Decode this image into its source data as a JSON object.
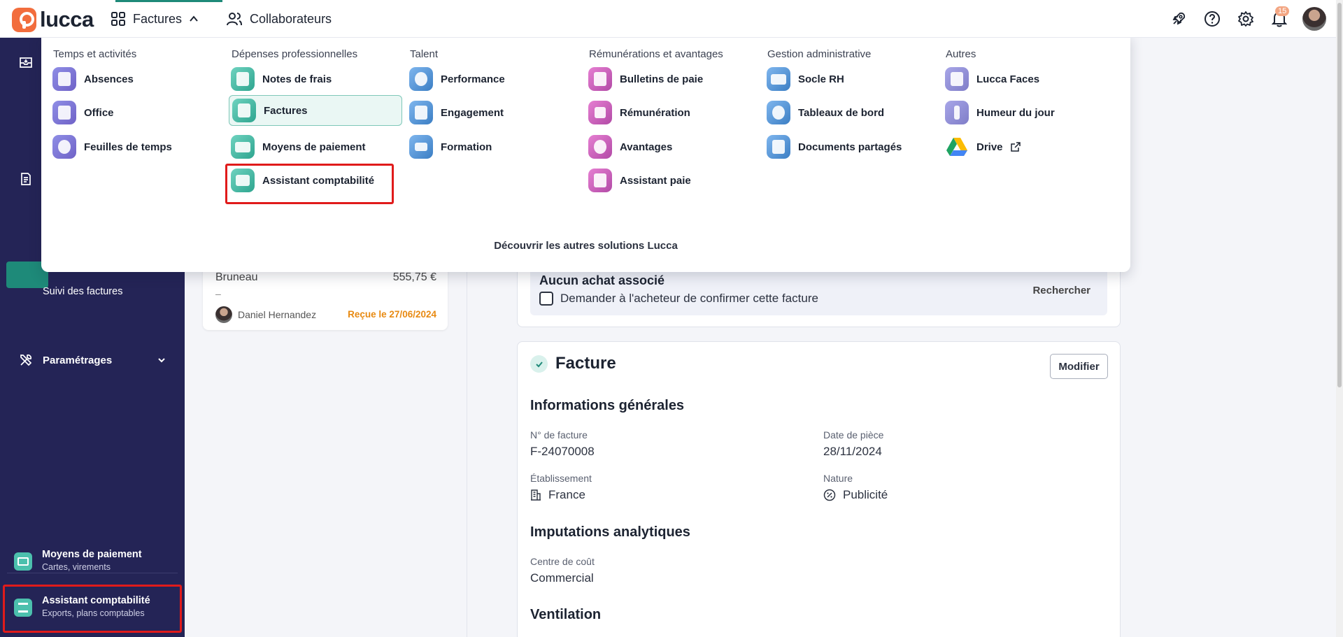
{
  "topbar": {
    "logo_text": "lucca",
    "nav": [
      {
        "label": "Factures",
        "icon": "grid-icon",
        "expanded": true
      },
      {
        "label": "Collaborateurs",
        "icon": "people-icon"
      }
    ],
    "notification_count": "15",
    "icons": [
      "rocket-icon",
      "help-icon",
      "settings-icon",
      "bell-icon"
    ]
  },
  "menu": {
    "columns": [
      {
        "title": "Temps et activités",
        "items": [
          "Absences",
          "Office",
          "Feuilles de temps"
        ]
      },
      {
        "title": "Dépenses professionnelles",
        "items": [
          "Notes de frais",
          "Factures",
          "Moyens de paiement",
          "Assistant comptabilité"
        ]
      },
      {
        "title": "Talent",
        "items": [
          "Performance",
          "Engagement",
          "Formation"
        ]
      },
      {
        "title": "Rémunérations et avantages",
        "items": [
          "Bulletins de paie",
          "Rémunération",
          "Avantages",
          "Assistant paie"
        ]
      },
      {
        "title": "Gestion administrative",
        "items": [
          "Socle RH",
          "Tableaux de bord",
          "Documents partagés"
        ]
      },
      {
        "title": "Autres",
        "items": [
          "Lucca Faces",
          "Humeur du jour",
          "Drive"
        ]
      }
    ],
    "selected": "Factures",
    "footer": "Découvrir les autres solutions Lucca"
  },
  "sidebar": {
    "links": [
      "Suivi des factures"
    ],
    "settings_label": "Paramétrages",
    "apps": [
      {
        "title": "Moyens de paiement",
        "subtitle": "Cartes, virements"
      },
      {
        "title": "Assistant comptabilité",
        "subtitle": "Exports, plans comptables"
      }
    ]
  },
  "list": {
    "item": {
      "name": "Bruneau",
      "amount": "555,75 €",
      "dash": "–",
      "person": "Daniel Hernandez",
      "status": "Reçue le 27/06/2024"
    }
  },
  "purchase": {
    "title": "Aucun achat associé",
    "checkbox_label": "Demander à l'acheteur de confirmer cette facture",
    "search_label": "Rechercher"
  },
  "invoice": {
    "title": "Facture",
    "edit_label": "Modifier",
    "general_title": "Informations générales",
    "fields": {
      "number_label": "N° de facture",
      "number_value": "F-24070008",
      "date_label": "Date de pièce",
      "date_value": "28/11/2024",
      "establishment_label": "Établissement",
      "establishment_value": "France",
      "nature_label": "Nature",
      "nature_value": "Publicité"
    },
    "analytics_title": "Imputations analytiques",
    "cost_center_label": "Centre de coût",
    "cost_center_value": "Commercial",
    "ventilation_title": "Ventilation"
  },
  "colors": {
    "sidebar": "#242456",
    "accent": "#1e8a79",
    "highlight": "#e01b1b",
    "status": "#e88a12"
  }
}
